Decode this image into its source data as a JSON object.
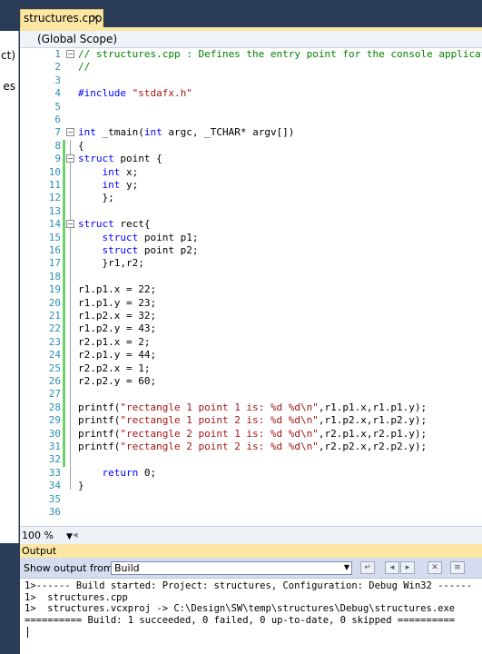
{
  "tab": {
    "title": "structures.cpp",
    "close_glyph": "✕"
  },
  "left_panel": {
    "fragments": [
      "ct)",
      "es"
    ]
  },
  "scope": {
    "value": "(Global Scope)"
  },
  "code": {
    "lines": [
      {
        "n": "1",
        "fold": "−",
        "parts": [
          [
            "c",
            "// structures.cpp : Defines the entry point for the console application."
          ]
        ]
      },
      {
        "n": "2",
        "parts": [
          [
            "c",
            "//"
          ]
        ]
      },
      {
        "n": "3",
        "parts": []
      },
      {
        "n": "4",
        "parts": [
          [
            "k",
            "#include"
          ],
          [
            "",
            " "
          ],
          [
            "s",
            "\"stdafx.h\""
          ]
        ]
      },
      {
        "n": "5",
        "parts": []
      },
      {
        "n": "6",
        "parts": []
      },
      {
        "n": "7",
        "fold": "−",
        "parts": [
          [
            "k",
            "int"
          ],
          [
            "",
            " _tmain("
          ],
          [
            "k",
            "int"
          ],
          [
            "",
            " argc, _TCHAR* argv[])"
          ]
        ]
      },
      {
        "n": "8",
        "chg": true,
        "parts": [
          [
            "",
            "{"
          ]
        ]
      },
      {
        "n": "9",
        "chg": true,
        "fold": "−",
        "parts": [
          [
            "k",
            "struct"
          ],
          [
            "",
            " point {"
          ]
        ]
      },
      {
        "n": "10",
        "chg": true,
        "parts": [
          [
            "",
            "    "
          ],
          [
            "k",
            "int"
          ],
          [
            "",
            " x;"
          ]
        ]
      },
      {
        "n": "11",
        "chg": true,
        "parts": [
          [
            "",
            "    "
          ],
          [
            "k",
            "int"
          ],
          [
            "",
            " y;"
          ]
        ]
      },
      {
        "n": "12",
        "chg": true,
        "parts": [
          [
            "",
            "    };"
          ]
        ]
      },
      {
        "n": "13",
        "chg": true,
        "parts": []
      },
      {
        "n": "14",
        "chg": true,
        "fold": "−",
        "parts": [
          [
            "k",
            "struct"
          ],
          [
            "",
            " rect{"
          ]
        ]
      },
      {
        "n": "15",
        "chg": true,
        "parts": [
          [
            "",
            "    "
          ],
          [
            "k",
            "struct"
          ],
          [
            "",
            " point p1;"
          ]
        ]
      },
      {
        "n": "16",
        "chg": true,
        "parts": [
          [
            "",
            "    "
          ],
          [
            "k",
            "struct"
          ],
          [
            "",
            " point p2;"
          ]
        ]
      },
      {
        "n": "17",
        "chg": true,
        "parts": [
          [
            "",
            "    }r1,r2;"
          ]
        ]
      },
      {
        "n": "18",
        "chg": true,
        "parts": []
      },
      {
        "n": "19",
        "chg": true,
        "parts": [
          [
            "",
            "r1.p1.x = 22;"
          ]
        ]
      },
      {
        "n": "20",
        "chg": true,
        "parts": [
          [
            "",
            "r1.p1.y = 23;"
          ]
        ]
      },
      {
        "n": "21",
        "chg": true,
        "parts": [
          [
            "",
            "r1.p2.x = 32;"
          ]
        ]
      },
      {
        "n": "22",
        "chg": true,
        "parts": [
          [
            "",
            "r1.p2.y = 43;"
          ]
        ]
      },
      {
        "n": "23",
        "chg": true,
        "parts": [
          [
            "",
            "r2.p1.x = 2;"
          ]
        ]
      },
      {
        "n": "24",
        "chg": true,
        "parts": [
          [
            "",
            "r2.p1.y = 44;"
          ]
        ]
      },
      {
        "n": "25",
        "chg": true,
        "parts": [
          [
            "",
            "r2.p2.x = 1;"
          ]
        ]
      },
      {
        "n": "26",
        "chg": true,
        "parts": [
          [
            "",
            "r2.p2.y = 60;"
          ]
        ]
      },
      {
        "n": "27",
        "chg": true,
        "parts": []
      },
      {
        "n": "28",
        "chg": true,
        "parts": [
          [
            "",
            "printf("
          ],
          [
            "s",
            "\"rectangle 1 point 1 is: %d %d\\n\""
          ],
          [
            "",
            ",r1.p1.x,r1.p1.y);"
          ]
        ]
      },
      {
        "n": "29",
        "chg": true,
        "parts": [
          [
            "",
            "printf("
          ],
          [
            "s",
            "\"rectangle 1 point 2 is: %d %d\\n\""
          ],
          [
            "",
            ",r1.p2.x,r1.p2.y);"
          ]
        ]
      },
      {
        "n": "30",
        "chg": true,
        "parts": [
          [
            "",
            "printf("
          ],
          [
            "s",
            "\"rectangle 2 point 1 is: %d %d\\n\""
          ],
          [
            "",
            ",r2.p1.x,r2.p1.y);"
          ]
        ]
      },
      {
        "n": "31",
        "chg": true,
        "parts": [
          [
            "",
            "printf("
          ],
          [
            "s",
            "\"rectangle 2 point 2 is: %d %d\\n\""
          ],
          [
            "",
            ",r2.p2.x,r2.p2.y);"
          ]
        ]
      },
      {
        "n": "32",
        "chg": true,
        "parts": []
      },
      {
        "n": "33",
        "parts": [
          [
            "",
            "    "
          ],
          [
            "k",
            "return"
          ],
          [
            "",
            " 0;"
          ]
        ]
      },
      {
        "n": "34",
        "parts": [
          [
            "",
            "}"
          ]
        ]
      },
      {
        "n": "35",
        "parts": []
      },
      {
        "n": "36",
        "parts": []
      }
    ]
  },
  "zoom": {
    "value": "100 %",
    "scroll_left_glyph": "◂"
  },
  "output": {
    "title": "Output",
    "show_label": "Show output from:",
    "source": "Build",
    "lines": [
      "1>------ Build started: Project: structures, Configuration: Debug Win32 ------",
      "1>  structures.cpp",
      "1>  structures.vcxproj -> C:\\Design\\SW\\temp\\structures\\Debug\\structures.exe",
      "========== Build: 1 succeeded, 0 failed, 0 up-to-date, 0 skipped =========="
    ]
  },
  "colors": {
    "frame": "#2b3c59",
    "tab_active": "#fbe6a3",
    "keyword": "#0000ff",
    "string": "#a31515",
    "comment": "#008000",
    "line_number": "#2b91af",
    "change_bar": "#6ed36e"
  }
}
